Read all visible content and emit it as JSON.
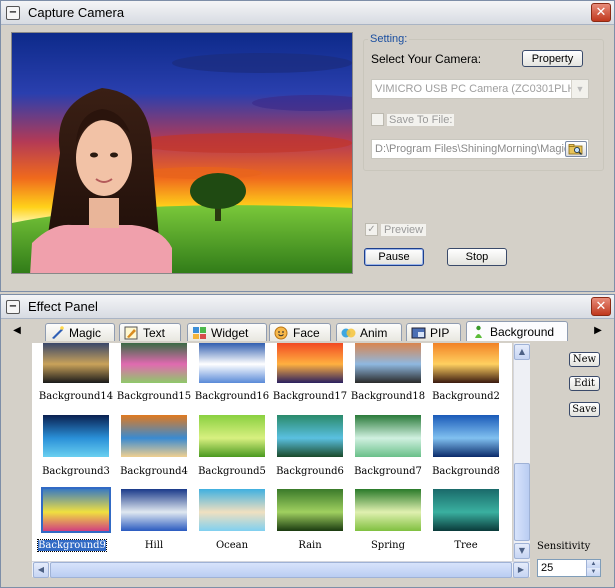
{
  "capture": {
    "title": "Capture Camera",
    "setting_label": "Setting:",
    "select_camera_label": "Select Your Camera:",
    "property_button": "Property",
    "camera_value": "VIMICRO USB PC Camera (ZC0301PLH)",
    "save_to_file_label": "Save To File:",
    "save_path": "D:\\Program Files\\ShiningMorning\\Magic",
    "preview_label": "Preview",
    "pause_button": "Pause",
    "stop_button": "Stop"
  },
  "effect": {
    "title": "Effect Panel",
    "tabs": [
      {
        "label": "Magic",
        "icon": "magic-icon"
      },
      {
        "label": "Text",
        "icon": "text-icon"
      },
      {
        "label": "Widget",
        "icon": "widget-icon"
      },
      {
        "label": "Face",
        "icon": "face-icon"
      },
      {
        "label": "Anim",
        "icon": "anim-icon"
      },
      {
        "label": "PIP",
        "icon": "pip-icon"
      },
      {
        "label": "Background",
        "icon": "background-icon"
      }
    ],
    "active_tab": "Background",
    "items": [
      "Background14",
      "Background15",
      "Background16",
      "Background17",
      "Background18",
      "Background2",
      "Background3",
      "Background4",
      "Background5",
      "Background6",
      "Background7",
      "Background8",
      "Background9",
      "Hill",
      "Ocean",
      "Rain",
      "Spring",
      "Tree"
    ],
    "selected_item": "Background9",
    "new_button": "New",
    "edit_button": "Edit",
    "save_button": "Save",
    "sensitivity_label": "Sensitivity",
    "sensitivity_value": "25"
  }
}
